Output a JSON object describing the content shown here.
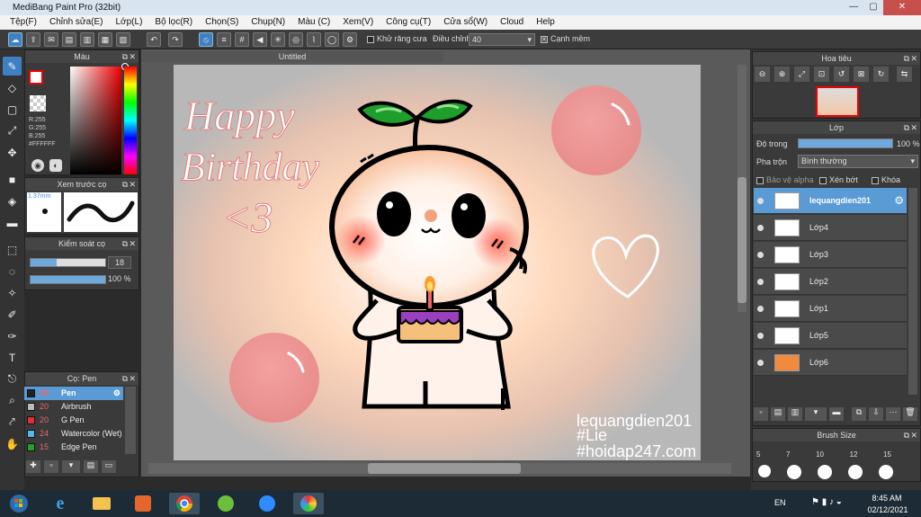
{
  "window": {
    "title": "MediBang Paint Pro (32bit)"
  },
  "menu": [
    "Tệp(F)",
    "Chỉnh sửa(E)",
    "Lớp(L)",
    "Bộ lọc(R)",
    "Chọn(S)",
    "Chụp(N)",
    "Màu (C)",
    "Xem(V)",
    "Công cụ(T)",
    "Cửa sổ(W)",
    "Cloud",
    "Help"
  ],
  "toolbar": {
    "antialias_label": "Khử răng cưa",
    "adjust_label": "Điều chỉnh",
    "adjust_value": "40",
    "smooth_label": "Cạnh mềm"
  },
  "document": {
    "tab_title": "Untitled"
  },
  "color_panel": {
    "title": "Màu",
    "r": "R:255",
    "g": "G:255",
    "b": "B:255",
    "hex": "#FFFFFF"
  },
  "preview_panel": {
    "title": "Xem trước cọ",
    "size": "1.37mm"
  },
  "control_panel": {
    "title": "Kiểm soát cọ",
    "size_value": "18",
    "opacity_value": "100 %"
  },
  "brush_panel": {
    "title": "Cọ: Pen",
    "items": [
      {
        "size": "18",
        "name": "Pen",
        "color": "#222222"
      },
      {
        "size": "20",
        "name": "Airbrush",
        "color": "#bbbbbb"
      },
      {
        "size": "20",
        "name": "G Pen",
        "color": "#e03030"
      },
      {
        "size": "24",
        "name": "Watercolor (Wet)",
        "color": "#56b8e8"
      },
      {
        "size": "15",
        "name": "Edge Pen",
        "color": "#2aa02a"
      }
    ]
  },
  "artwork": {
    "line1": "Happy",
    "line2": "Birthday",
    "line3": "<3",
    "watermark1": "lequangdien201",
    "watermark2": "#Lie",
    "watermark3": "#hoidap247.com"
  },
  "navigator": {
    "title": "Hoa tiêu"
  },
  "layer_panel": {
    "title": "Lớp",
    "opacity_label": "Độ trong",
    "opacity_value": "100 %",
    "blend_label": "Pha trộn",
    "blend_value": "Bình thường",
    "protect_alpha": "Bảo vệ alpha",
    "clipping": "Xén bớt",
    "lock": "Khóa",
    "layers": [
      "lequangdien201",
      "Lớp4",
      "Lớp3",
      "Lớp2",
      "Lớp1",
      "Lớp5",
      "Lớp6"
    ]
  },
  "brush_size_panel": {
    "title": "Brush Size",
    "sizes": [
      "5",
      "7",
      "10",
      "12",
      "15"
    ]
  },
  "taskbar": {
    "lang": "EN",
    "time": "8:45 AM",
    "date": "02/12/2021"
  },
  "colors": {
    "accent": "#5b9bd5",
    "panel": "#3a3a3a",
    "canvas_bg": "#b9b9b9"
  }
}
